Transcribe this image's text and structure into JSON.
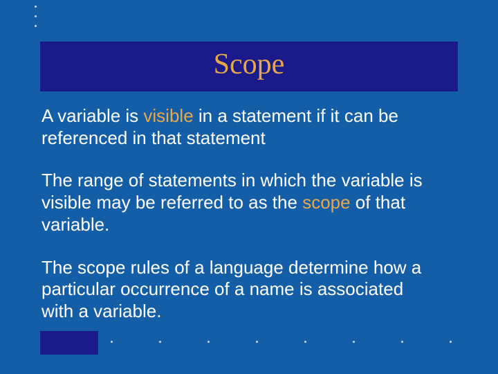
{
  "title": "Scope",
  "para1": {
    "t1": "A variable is ",
    "em": "visible",
    "t2": " in a statement if it can be referenced in that statement"
  },
  "para2": {
    "t1": "The range of statements in which the variable is visible may be referred to as  the ",
    "em": "scope",
    "t2": " of that variable."
  },
  "para3": {
    "t1": "The scope rules of a language determine how a particular occurrence of a name is associated with a variable."
  }
}
